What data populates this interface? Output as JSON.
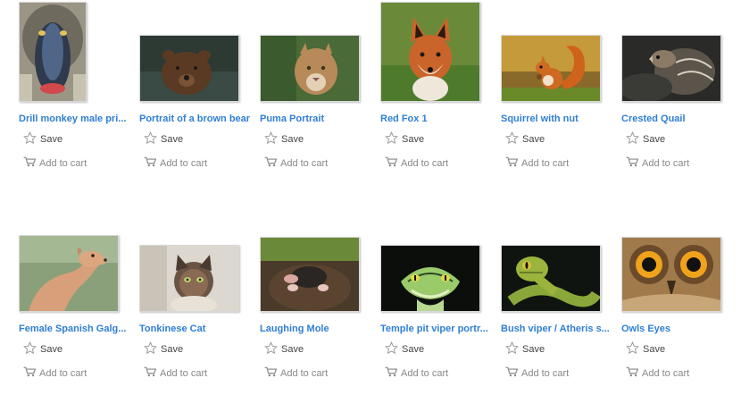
{
  "items": [
    {
      "title": "Drill monkey male pri...",
      "save": "Save",
      "cart": "Add to cart",
      "thumb_icon": "mandrill-photo"
    },
    {
      "title": "Portrait of a brown bear",
      "save": "Save",
      "cart": "Add to cart",
      "thumb_icon": "brown-bear-photo"
    },
    {
      "title": "Puma Portrait",
      "save": "Save",
      "cart": "Add to cart",
      "thumb_icon": "puma-photo"
    },
    {
      "title": "Red Fox 1",
      "save": "Save",
      "cart": "Add to cart",
      "thumb_icon": "red-fox-photo"
    },
    {
      "title": "Squirrel with nut",
      "save": "Save",
      "cart": "Add to cart",
      "thumb_icon": "squirrel-photo"
    },
    {
      "title": "Crested Quail",
      "save": "Save",
      "cart": "Add to cart",
      "thumb_icon": "quail-photo"
    },
    {
      "title": "Female Spanish Galg...",
      "save": "Save",
      "cart": "Add to cart",
      "thumb_icon": "greyhound-photo"
    },
    {
      "title": "Tonkinese Cat",
      "save": "Save",
      "cart": "Add to cart",
      "thumb_icon": "cat-photo"
    },
    {
      "title": "Laughing Mole",
      "save": "Save",
      "cart": "Add to cart",
      "thumb_icon": "mole-photo"
    },
    {
      "title": "Temple pit viper portr...",
      "save": "Save",
      "cart": "Add to cart",
      "thumb_icon": "pit-viper-photo"
    },
    {
      "title": "Bush viper / Atheris s...",
      "save": "Save",
      "cart": "Add to cart",
      "thumb_icon": "bush-viper-photo"
    },
    {
      "title": "Owls Eyes",
      "save": "Save",
      "cart": "Add to cart",
      "thumb_icon": "owl-eyes-photo"
    }
  ],
  "colors": {
    "title_link": "#2f7fd4",
    "action_text": "#7a7a7a"
  }
}
